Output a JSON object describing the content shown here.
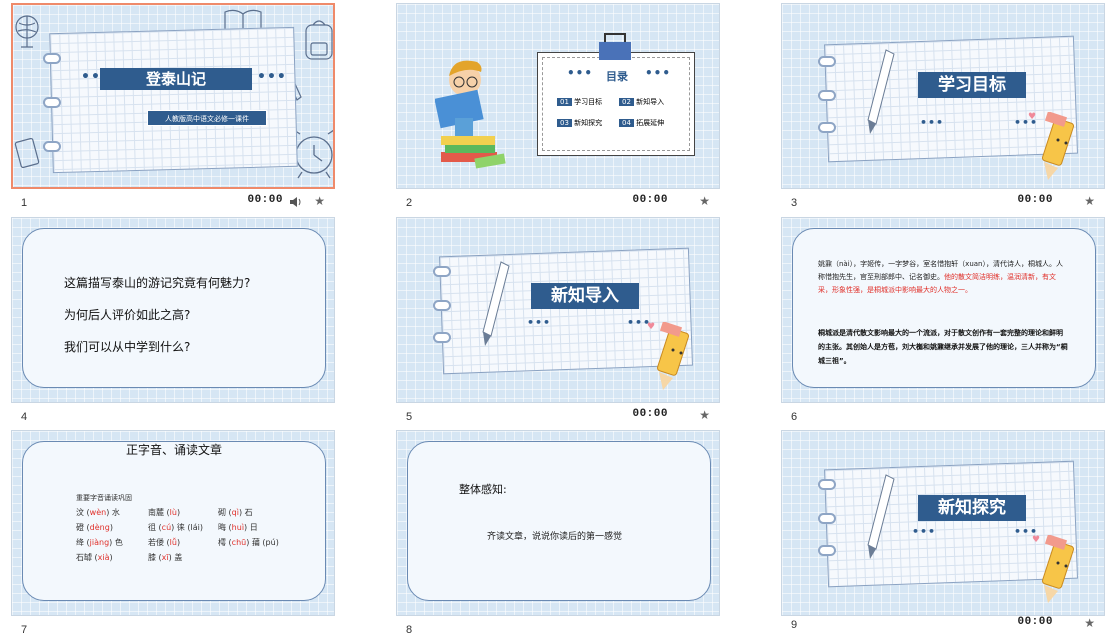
{
  "slides": [
    {
      "number": "1",
      "time": "00:00",
      "title": "登泰山记",
      "subtitle": "人教版高中语文必修一课件",
      "selected": true,
      "has_audio": true
    },
    {
      "number": "2",
      "time": "00:00",
      "title": "目录",
      "toc": [
        {
          "num": "01",
          "label": "学习目标"
        },
        {
          "num": "02",
          "label": "新知导入"
        },
        {
          "num": "03",
          "label": "新知探究"
        },
        {
          "num": "04",
          "label": "拓展延伸"
        }
      ]
    },
    {
      "number": "3",
      "time": "00:00",
      "title": "学习目标"
    },
    {
      "number": "4",
      "time": "",
      "lines": [
        "这篇描写泰山的游记究竟有何魅力?",
        "为何后人评价如此之高?",
        "我们可以从中学到什么?"
      ]
    },
    {
      "number": "5",
      "time": "00:00",
      "title": "新知导入"
    },
    {
      "number": "6",
      "time": "",
      "p1": "姚鼐（nài），字姬传，一字梦谷，室名惜抱轩（xuan），清代诗人，桐城人。人称惜抱先生，官至刑部郎中、记名御史。",
      "p1_red": "他的散文简洁明练，温润清新，有文采，形象性强，是桐城派中影响最大的人物之一。",
      "p2": "桐城派是清代散文影响最大的一个流派，对于散文创作有一套完整的理论和鲜明的主张。其创始人是方苞，刘大櫆和姚鼐继承并发展了他的理论，三人并称为“桐城三祖”。"
    },
    {
      "number": "7",
      "time": "",
      "title": "正字音、诵读文章",
      "heading": "重要字音诵读巩固",
      "rows": [
        [
          {
            "c": "汶",
            "p": "wèn",
            "s": "水"
          },
          {
            "c": "南麓",
            "p": "lù",
            "s": ""
          },
          {
            "c": "砌",
            "p": "qì",
            "s": "石"
          }
        ],
        [
          {
            "c": "磴",
            "p": "dèng",
            "s": ""
          },
          {
            "c": "徂",
            "p": "cú",
            "s": "徕 (lái)"
          },
          {
            "c": "晦",
            "p": "huì",
            "s": "日"
          }
        ],
        [
          {
            "c": "绛",
            "p": "jiàng",
            "s": "色"
          },
          {
            "c": "若偻",
            "p": "lǚ",
            "s": ""
          },
          {
            "c": "樗",
            "p": "chū",
            "s": "蒱 (pú)"
          }
        ],
        [
          {
            "c": "石罅",
            "p": "xià",
            "s": ""
          },
          {
            "c": "膝",
            "p": "xī",
            "s": "盖"
          }
        ]
      ]
    },
    {
      "number": "8",
      "time": "",
      "title": "整体感知:",
      "body": "齐读文章，说说你读后的第一感觉"
    },
    {
      "number": "9",
      "time": "00:00",
      "title": "新知探究"
    }
  ],
  "colors": {
    "accent": "#2f5c8e",
    "selection": "#ef8a6a",
    "red_text": "#e0302a"
  },
  "icons": [
    "speaker-icon",
    "star-icon",
    "pencil-icon",
    "clipboard-icon",
    "book-reader-icon",
    "alarm-clock-icon",
    "globe-icon",
    "backpack-icon"
  ]
}
